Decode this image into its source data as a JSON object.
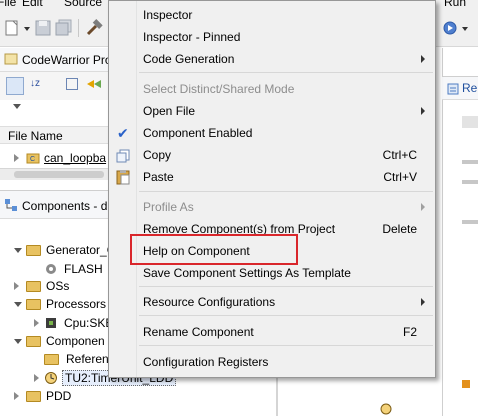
{
  "menubar": {
    "items": [
      "File",
      "Edit",
      "Source",
      "Run"
    ]
  },
  "codewarrior_panel": {
    "title": "CodeWarrior Pro",
    "column_header": "File Name",
    "tree_items": [
      "can_loopba"
    ]
  },
  "components_panel": {
    "title": "Components - d",
    "tree": [
      "Generator_C",
      "FLASH",
      "OSs",
      "Processors",
      "Cpu:SKE",
      "Componen",
      "Referenc",
      "TU2:TimerUnit_LDD",
      "PDD"
    ]
  },
  "right_panel": {
    "tab_label": "Re"
  },
  "context_menu": {
    "items": [
      {
        "label": "Inspector",
        "enabled": true
      },
      {
        "label": "Inspector - Pinned",
        "enabled": true
      },
      {
        "label": "Code Generation",
        "enabled": true,
        "submenu": true
      },
      {
        "label": "Select Distinct/Shared Mode",
        "enabled": false
      },
      {
        "label": "Open File",
        "enabled": true,
        "submenu": true
      },
      {
        "label": "Component Enabled",
        "enabled": true,
        "checked": true
      },
      {
        "label": "Copy",
        "enabled": true,
        "shortcut": "Ctrl+C"
      },
      {
        "label": "Paste",
        "enabled": true,
        "shortcut": "Ctrl+V"
      },
      {
        "label": "Profile As",
        "enabled": false,
        "submenu": true
      },
      {
        "label": "Remove Component(s) from Project",
        "enabled": true,
        "shortcut": "Delete"
      },
      {
        "label": "Help on Component",
        "enabled": true,
        "highlighted": true
      },
      {
        "label": "Save Component Settings As Template",
        "enabled": true
      },
      {
        "label": "Resource Configurations",
        "enabled": true,
        "submenu": true
      },
      {
        "label": "Rename Component",
        "enabled": true,
        "shortcut": "F2"
      },
      {
        "label": "Configuration Registers",
        "enabled": true
      }
    ]
  },
  "colors": {
    "highlight_border": "#d9262b",
    "check": "#2a62c9"
  }
}
